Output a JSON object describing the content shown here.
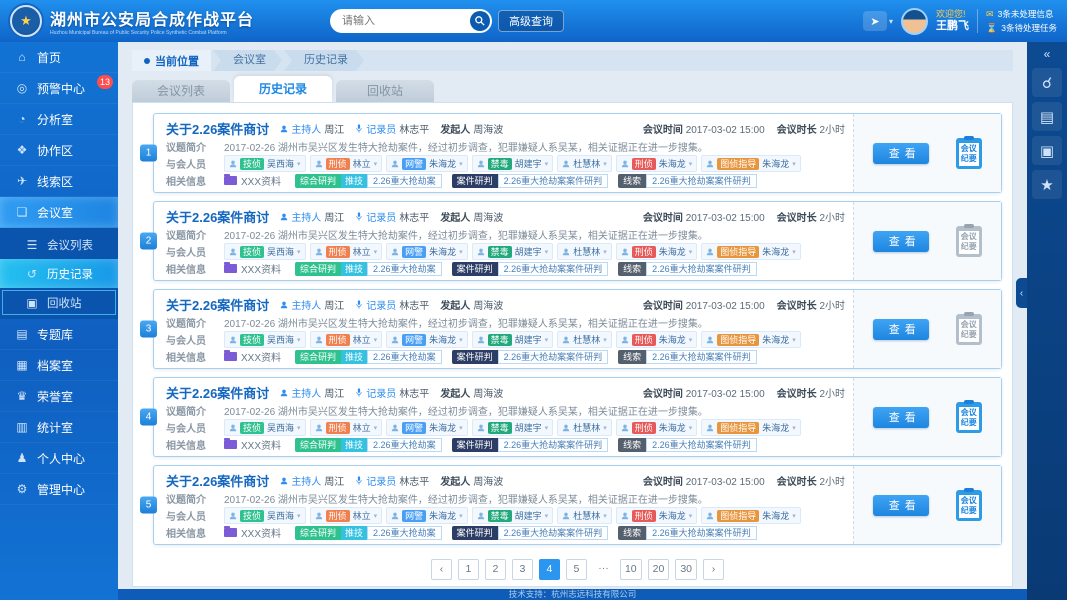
{
  "header": {
    "logo_glyph": "★",
    "title": "湖州市公安局合成作战平台",
    "subtitle": "Huzhou Municipal Bureau of Public Security Police Synthetic Combat Platform",
    "search_placeholder": "请输入",
    "advanced_query_label": "高级查询",
    "share_glyph": "➤",
    "share_caret": "▾",
    "welcome": "欢迎您!",
    "username": "王鹏飞",
    "notices": [
      {
        "icon": "✉",
        "color": "#ffd24a",
        "text": "3条未处理信息"
      },
      {
        "icon": "⌛",
        "color": "#ff7a45",
        "text": "3条待处理任务"
      }
    ]
  },
  "sidebar": {
    "top_items": [
      {
        "icon": "⌂",
        "label": "首页",
        "cls": "",
        "badge": ""
      },
      {
        "icon": "◎",
        "label": "预警中心",
        "cls": "",
        "badge": "13"
      },
      {
        "icon": "◔",
        "label": "分析室",
        "cls": "",
        "badge": ""
      },
      {
        "icon": "❖",
        "label": "协作区",
        "cls": "",
        "badge": ""
      },
      {
        "icon": "✈",
        "label": "线索区",
        "cls": "",
        "badge": ""
      },
      {
        "icon": "❏",
        "label": "会议室",
        "cls": "active",
        "badge": ""
      }
    ],
    "sub_items": [
      {
        "icon": "☰",
        "label": "会议列表",
        "cls": ""
      },
      {
        "icon": "↺",
        "label": "历史记录",
        "cls": "active"
      },
      {
        "icon": "▣",
        "label": "回收站",
        "cls": "recycle"
      }
    ],
    "bottom_items": [
      {
        "icon": "▤",
        "label": "专题库",
        "cls": "",
        "badge": ""
      },
      {
        "icon": "▦",
        "label": "档案室",
        "cls": "",
        "badge": ""
      },
      {
        "icon": "♛",
        "label": "荣誉室",
        "cls": "",
        "badge": ""
      },
      {
        "icon": "▥",
        "label": "统计室",
        "cls": "",
        "badge": ""
      },
      {
        "icon": "♟",
        "label": "个人中心",
        "cls": "",
        "badge": ""
      },
      {
        "icon": "⚙",
        "label": "管理中心",
        "cls": "",
        "badge": ""
      }
    ]
  },
  "rightbar": {
    "collapse_glyph": "«",
    "search_glyph": "☌",
    "save_glyph": "▤",
    "monitor_glyph": "▣",
    "star_glyph": "★",
    "handle_glyph": "‹"
  },
  "breadcrumb": {
    "location_label": "当前位置",
    "items": [
      "会议室",
      "历史记录"
    ]
  },
  "tabs": [
    {
      "label": "会议列表",
      "cls": ""
    },
    {
      "label": "历史记录",
      "cls": "active"
    },
    {
      "label": "回收站",
      "cls": ""
    }
  ],
  "card": {
    "title": "关于2.26案件商讨",
    "host_label": "主持人",
    "host": "周江",
    "recorder_label": "记录员",
    "recorder": "林志平",
    "initiator_label": "发起人",
    "initiator": "周海波",
    "time_label": "会议时间",
    "time": "2017-03-02  15:00",
    "duration_label": "会议时长",
    "duration": "2小时",
    "summary_label": "议题简介",
    "summary": "2017-02-26 湖州市吴兴区发生特大抢劫案件，经过初步调查，犯罪嫌疑人系吴某，相关证据正在进一步搜集。",
    "attendees_label": "与会人员",
    "caret_glyph": "▾",
    "attendees": [
      {
        "dept": "技侦",
        "color": "#2fc28f",
        "name": "吴西海"
      },
      {
        "dept": "刑侦",
        "color": "#f0814f",
        "name": "林立"
      },
      {
        "dept": "网警",
        "color": "#4a9ff5",
        "name": "朱海龙"
      },
      {
        "dept": "禁毒",
        "color": "#23a97c",
        "name": "胡建宇"
      },
      {
        "dept": "",
        "color": "",
        "name": "杜慧林"
      },
      {
        "dept": "刑侦",
        "color": "#e85a5a",
        "name": "朱海龙"
      },
      {
        "dept": "图侦指导",
        "color": "#e8963e",
        "name": "朱海龙"
      }
    ],
    "info_label": "相关信息",
    "material": "XXX资料",
    "info_groups": [
      {
        "tag": "综合研判",
        "tag_color": "#2fc28f",
        "sub": "推技",
        "chip": "2.26重大抢劫案"
      },
      {
        "tag": "案件研判",
        "tag_color": "#2d3e66",
        "sub": "",
        "chip": "2.26重大抢劫案案件研判"
      },
      {
        "tag": "线索",
        "tag_color": "#55606e",
        "sub": "",
        "chip": "2.26重大抢劫案案件研判"
      }
    ],
    "view_label": "查看",
    "minutes_label": "会议纪要"
  },
  "meetings": [
    {
      "index": "1",
      "minutes_cls": ""
    },
    {
      "index": "2",
      "minutes_cls": "disabled"
    },
    {
      "index": "3",
      "minutes_cls": "disabled"
    },
    {
      "index": "4",
      "minutes_cls": ""
    },
    {
      "index": "5",
      "minutes_cls": ""
    }
  ],
  "pagination": {
    "prev": "‹",
    "next": "›",
    "pages": [
      {
        "label": "1",
        "cls": ""
      },
      {
        "label": "2",
        "cls": ""
      },
      {
        "label": "3",
        "cls": ""
      },
      {
        "label": "4",
        "cls": "active"
      },
      {
        "label": "5",
        "cls": ""
      },
      {
        "label": "···",
        "cls": "dots"
      },
      {
        "label": "10",
        "cls": ""
      },
      {
        "label": "20",
        "cls": ""
      },
      {
        "label": "30",
        "cls": ""
      }
    ]
  },
  "footer": {
    "text": "技术支持：杭州志远科技有限公司"
  }
}
